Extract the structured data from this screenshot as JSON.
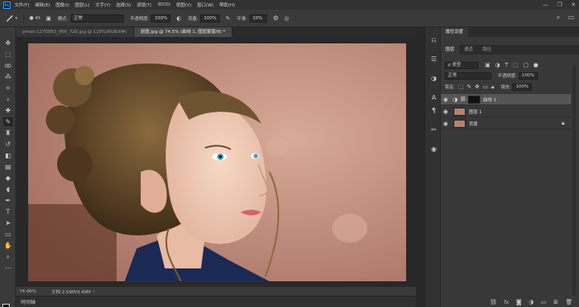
{
  "app": {
    "logo_text": "Ps"
  },
  "menu": [
    {
      "label": "文件(F)"
    },
    {
      "label": "编辑(E)"
    },
    {
      "label": "图像(I)"
    },
    {
      "label": "图层(L)"
    },
    {
      "label": "文字(Y)"
    },
    {
      "label": "选择(S)"
    },
    {
      "label": "滤镜(T)"
    },
    {
      "label": "3D(D)"
    },
    {
      "label": "视图(V)"
    },
    {
      "label": "窗口(W)"
    },
    {
      "label": "帮助(H)"
    }
  ],
  "window_controls": {
    "minimize": "—",
    "restore": "❐",
    "close": "✕"
  },
  "options": {
    "brush_size": "45",
    "mode_label": "模式:",
    "mode_value": "正常",
    "opacity_label": "不透明度:",
    "opacity_value": "100%",
    "flow_label": "流量:",
    "flow_value": "100%",
    "smooth_label": "平滑:",
    "smooth_value": "10%"
  },
  "tabs": [
    {
      "label": "pmon-1270953_960_720.jpg @ 118%(RGB/8#)",
      "active": false
    },
    {
      "label": "原图.jpg @ 74.5% (曲线 1, 图层蒙版/8) *",
      "active": true
    }
  ],
  "status": {
    "zoom": "74.46%",
    "doc_info": "文档:2.59M/9.49M"
  },
  "timeline": {
    "label": "时间轴"
  },
  "panels": {
    "top_tab": "属性设置",
    "tabs": [
      {
        "label": "图层",
        "active": true
      },
      {
        "label": "通道",
        "active": false
      },
      {
        "label": "路径",
        "active": false
      }
    ],
    "filter_kind": "ρ 类型",
    "blend_mode": "正常",
    "opacity_label": "不透明度:",
    "opacity_value": "100%",
    "lock_label": "锁定:",
    "fill_label": "填充:",
    "fill_value": "100%"
  },
  "layers": [
    {
      "name": "曲线 1",
      "selected": true
    },
    {
      "name": "图层 1",
      "selected": false
    },
    {
      "name": "背景",
      "selected": false
    }
  ],
  "colors": {
    "accent": "#31a8ff",
    "photo_background": "#c59585",
    "selected_layer": "#555555"
  }
}
